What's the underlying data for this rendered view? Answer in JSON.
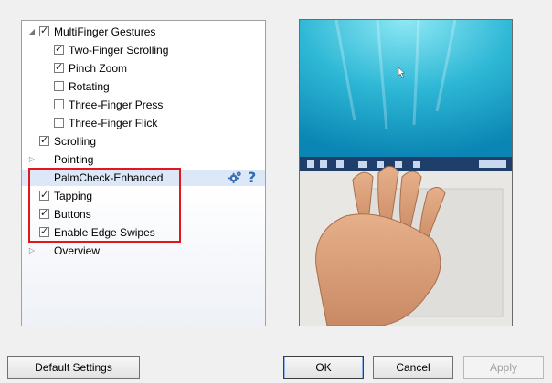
{
  "tree": {
    "items": [
      {
        "label": "MultiFinger Gestures",
        "checked": true,
        "has_checkbox": true,
        "expander": "expanded"
      },
      {
        "label": "Two-Finger Scrolling",
        "checked": true,
        "has_checkbox": true
      },
      {
        "label": "Pinch Zoom",
        "checked": true,
        "has_checkbox": true
      },
      {
        "label": "Rotating",
        "checked": false,
        "has_checkbox": true
      },
      {
        "label": "Three-Finger Press",
        "checked": false,
        "has_checkbox": true
      },
      {
        "label": "Three-Finger Flick",
        "checked": false,
        "has_checkbox": true
      },
      {
        "label": "Scrolling",
        "checked": true,
        "has_checkbox": true
      },
      {
        "label": "Pointing",
        "has_checkbox": false,
        "expander": "collapsed"
      },
      {
        "label": "PalmCheck-Enhanced",
        "has_checkbox": false,
        "selected": true
      },
      {
        "label": "Tapping",
        "checked": true,
        "has_checkbox": true
      },
      {
        "label": "Buttons",
        "checked": true,
        "has_checkbox": true
      },
      {
        "label": "Enable Edge Swipes",
        "checked": true,
        "has_checkbox": true
      },
      {
        "label": "Overview",
        "has_checkbox": false,
        "expander": "collapsed"
      }
    ],
    "selected_row_icons": [
      "gear-icon",
      "help-icon"
    ],
    "help_glyph": "?"
  },
  "buttons": {
    "default_settings": "Default Settings",
    "ok": "OK",
    "cancel": "Cancel",
    "apply": "Apply"
  },
  "colors": {
    "highlight_border": "#e2161b",
    "selected_row": "#dce8f8",
    "accent": "#2f6db3"
  }
}
